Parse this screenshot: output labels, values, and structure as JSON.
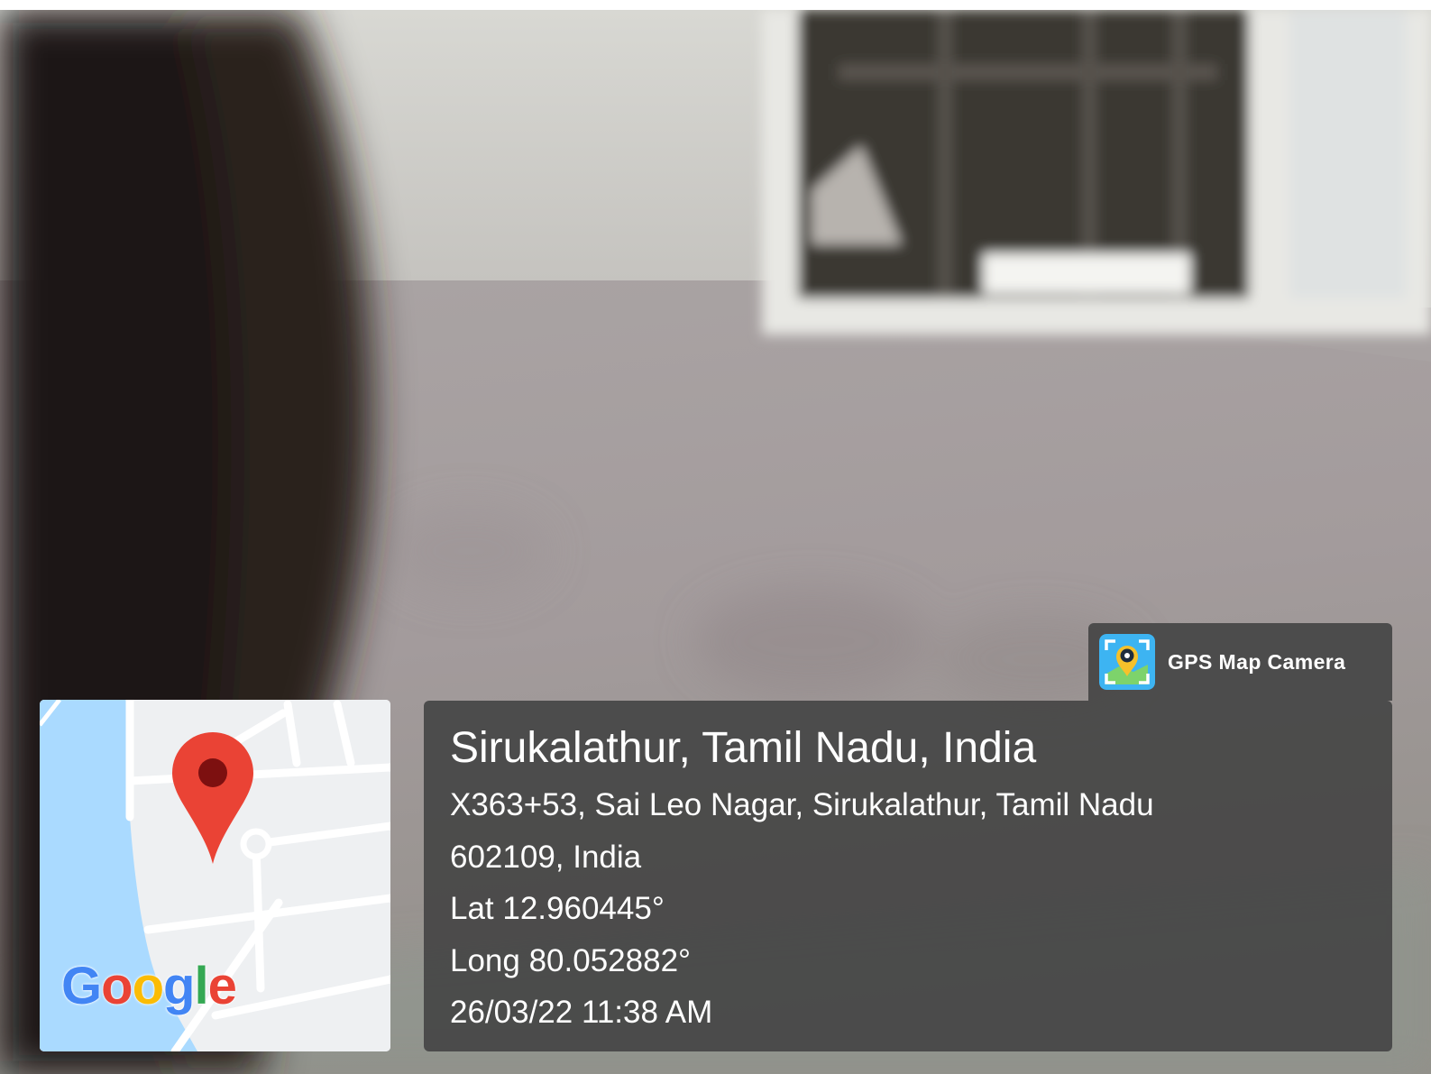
{
  "stamp": {
    "app_name": "GPS Map Camera",
    "place": "Sirukalathur, Tamil Nadu, India",
    "address_line1": "X363+53, Sai Leo Nagar, Sirukalathur, Tamil Nadu",
    "address_line2": "602109, India",
    "latitude": "Lat 12.960445°",
    "longitude": "Long 80.052882°",
    "datetime": "26/03/22 11:38 AM"
  },
  "map": {
    "logo_text": "Google",
    "marker_color": "#ea4335",
    "water_color": "#aadaff"
  },
  "colors": {
    "panel": "#464646",
    "text": "#ffffff"
  }
}
